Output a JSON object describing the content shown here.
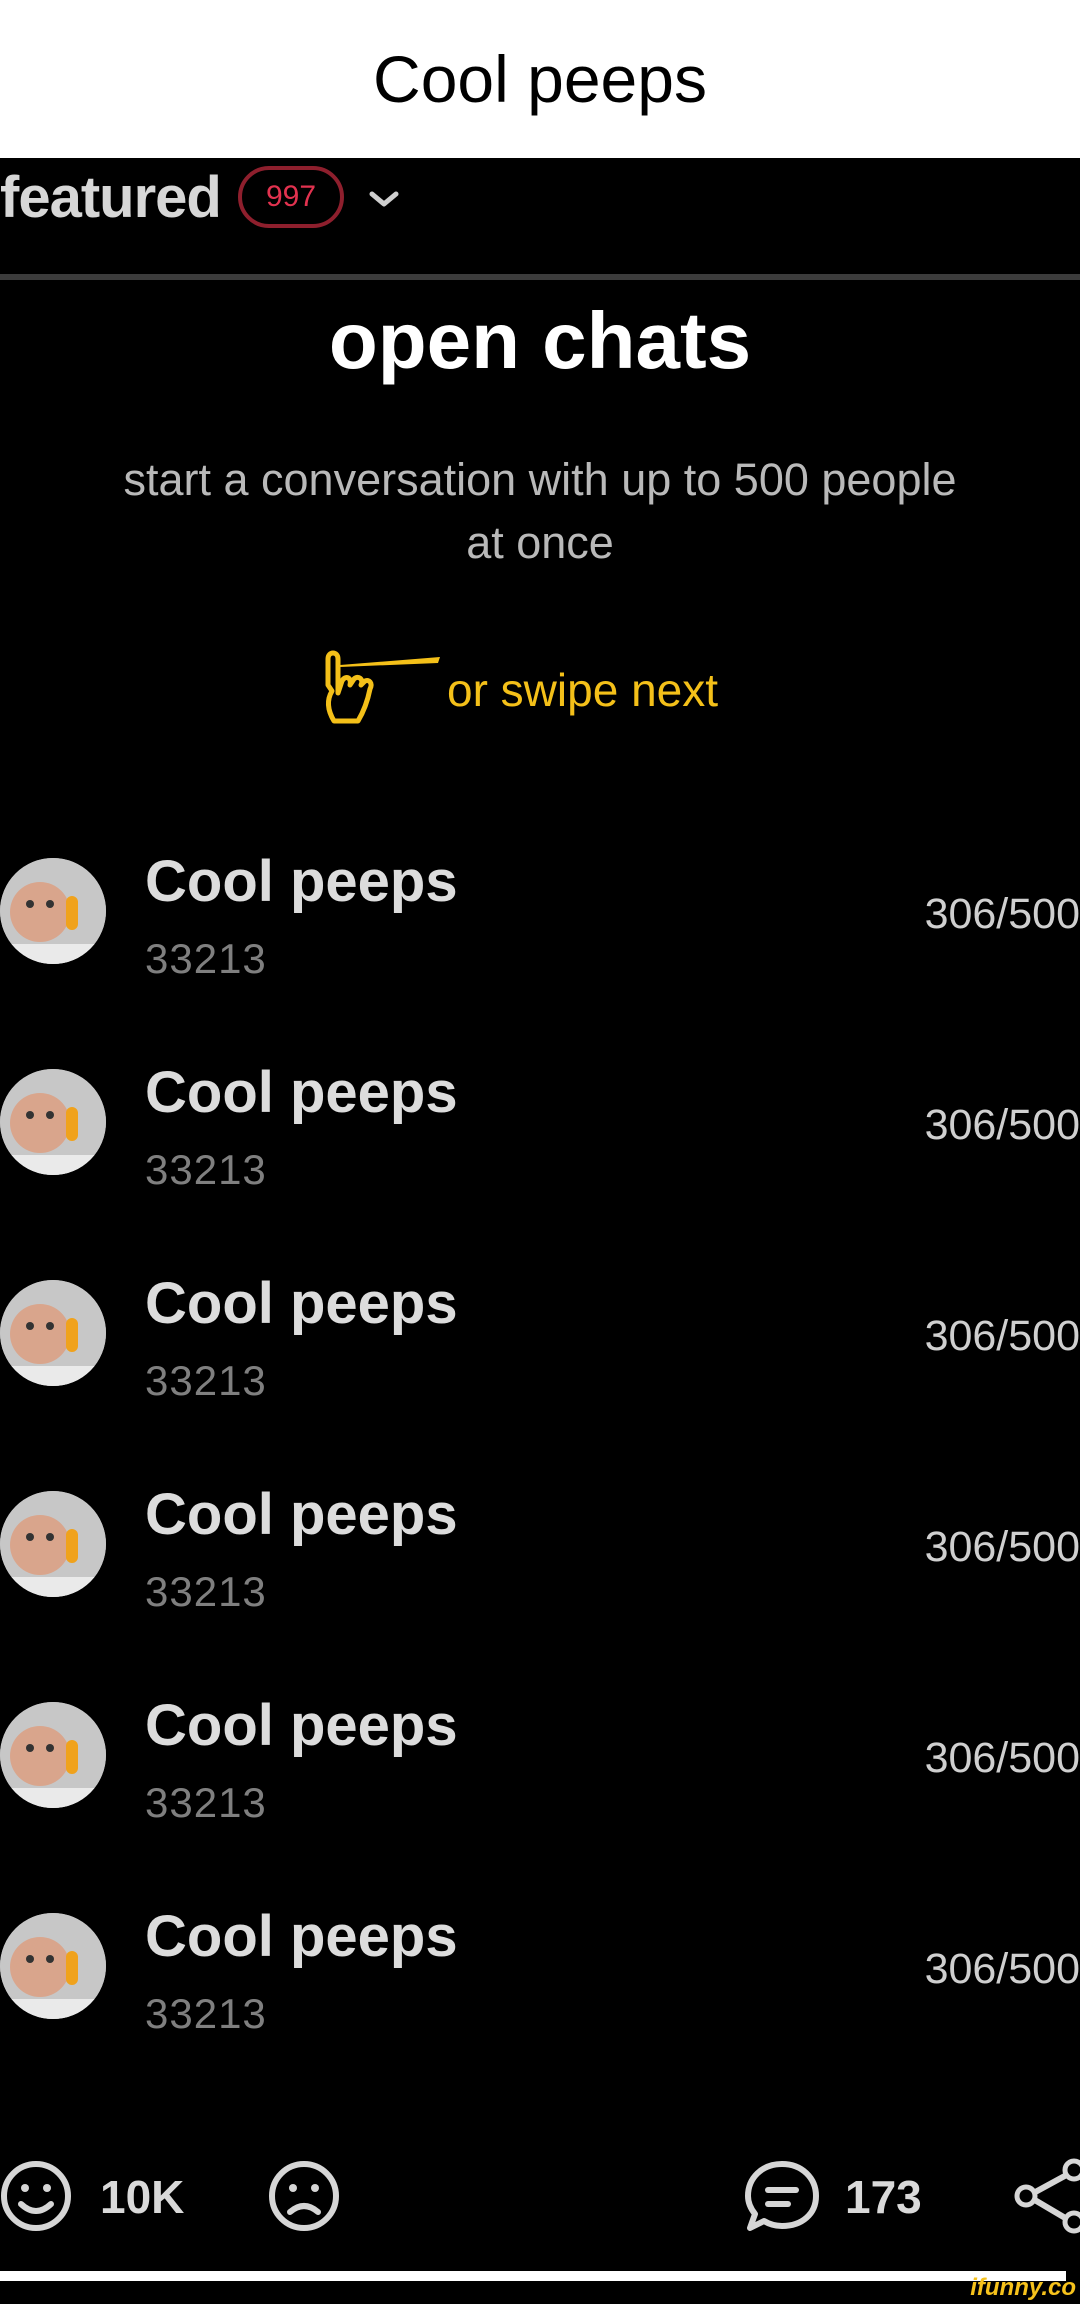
{
  "caption": "Cool peeps",
  "featured": {
    "label": "featured",
    "badge": "997"
  },
  "heading": "open chats",
  "subtitle": "start a conversation with up to 500 people at once",
  "swipe_hint": "or swipe next",
  "chats": [
    {
      "title": "Cool peeps",
      "id": "33213",
      "members": "306/500"
    },
    {
      "title": "Cool peeps",
      "id": "33213",
      "members": "306/500"
    },
    {
      "title": "Cool peeps",
      "id": "33213",
      "members": "306/500"
    },
    {
      "title": "Cool peeps",
      "id": "33213",
      "members": "306/500"
    },
    {
      "title": "Cool peeps",
      "id": "33213",
      "members": "306/500"
    },
    {
      "title": "Cool peeps",
      "id": "33213",
      "members": "306/500"
    }
  ],
  "actions": {
    "smile_count": "10K",
    "comment_count": "173"
  },
  "icons": [
    "chevron-down-icon",
    "pointing-hand-icon",
    "smile-icon",
    "frown-icon",
    "comment-icon",
    "share-icon"
  ],
  "watermark": "ifunny.co",
  "colors": {
    "badge": "#e2324f",
    "swipe": "#f4c019",
    "background": "#000000"
  }
}
